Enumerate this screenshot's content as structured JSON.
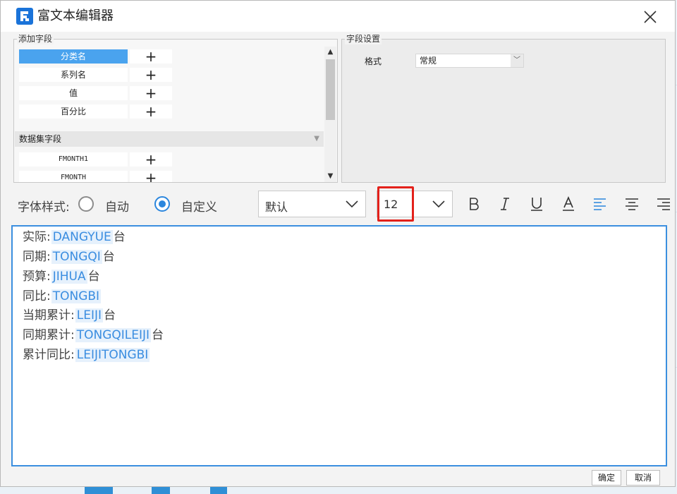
{
  "window": {
    "title": "富文本编辑器"
  },
  "colors": {
    "accent": "#2b86dd",
    "selection": "#4aa3ee",
    "highlight": "#e3211b",
    "tag_bg": "#e6f1fc"
  },
  "icons": [
    "app-logo-icon",
    "close-icon",
    "plus-icon",
    "scroll-up-icon",
    "scroll-down-icon",
    "chevron-down-icon",
    "bold-icon",
    "italic-icon",
    "underline-icon",
    "font-color-icon",
    "align-left-icon",
    "align-center-icon",
    "align-right-icon"
  ],
  "add_fields": {
    "legend": "添加字段",
    "items": [
      {
        "name": "分类名",
        "selected": true
      },
      {
        "name": "系列名"
      },
      {
        "name": "值"
      },
      {
        "name": "百分比"
      }
    ],
    "dataset_header": "数据集字段",
    "dataset_items": [
      {
        "name": "FMONTH1"
      },
      {
        "name": "FMONTH"
      }
    ]
  },
  "field_settings": {
    "legend": "字段设置",
    "format_label": "格式",
    "format_value": "常规"
  },
  "toolbar": {
    "font_style_label": "字体样式:",
    "radio_auto": "自动",
    "radio_custom": "自定义",
    "font_family": "默认",
    "font_size": "12"
  },
  "editor": {
    "lines": [
      {
        "label": "实际:",
        "field": "DANGYUE",
        "suffix": "台"
      },
      {
        "label": "同期:",
        "field": "TONGQI",
        "suffix": "台"
      },
      {
        "label": "预算:",
        "field": "JIHUA",
        "suffix": "台"
      },
      {
        "label": "同比:",
        "field": "TONGBI",
        "suffix": ""
      },
      {
        "label": "当期累计:",
        "field": "LEIJI",
        "suffix": "台"
      },
      {
        "label": "同期累计:",
        "field": "TONGQILEIJI",
        "suffix": "台"
      },
      {
        "label": "累计同比:",
        "field": "LEIJITONGBI",
        "suffix": ""
      }
    ]
  },
  "buttons": {
    "ok": "确定",
    "cancel": "取消"
  }
}
